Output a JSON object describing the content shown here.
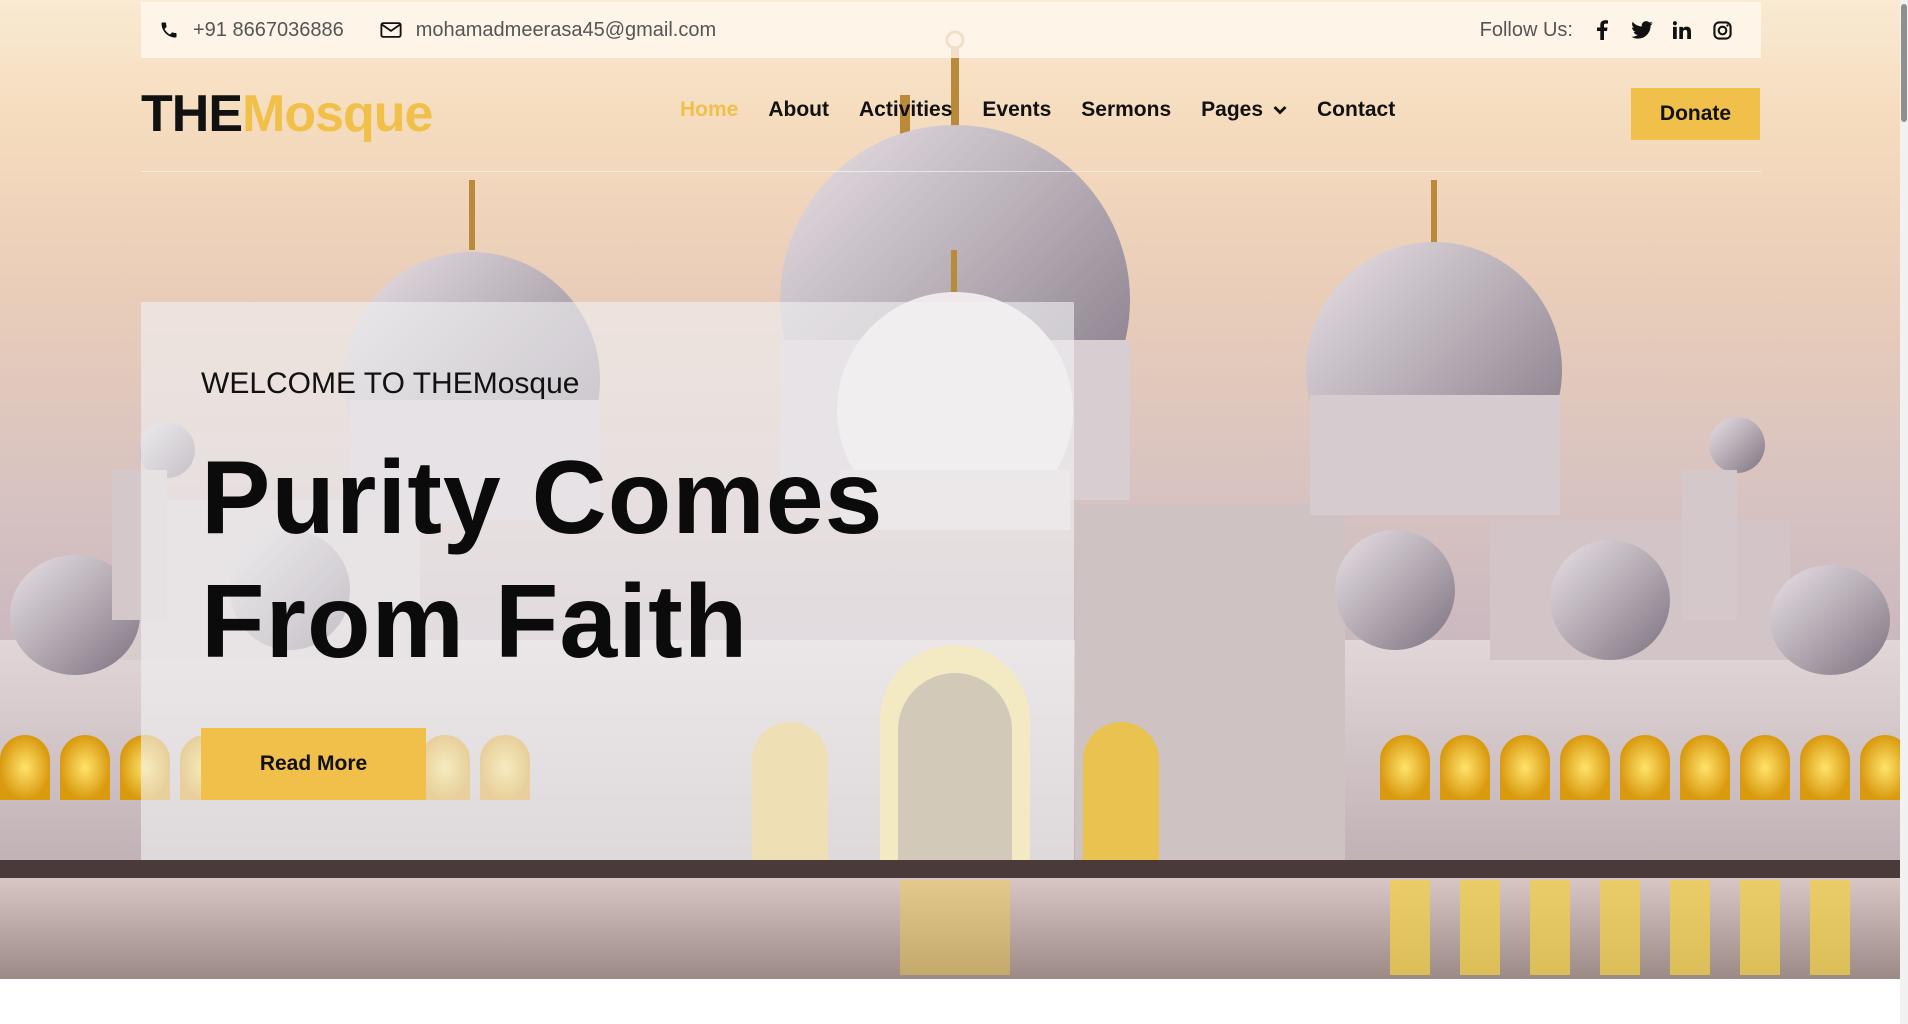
{
  "topbar": {
    "phone": "+91 8667036886",
    "email": "mohamadmeerasa45@gmail.com",
    "follow_label": "Follow Us:",
    "social_icons": [
      "facebook-icon",
      "twitter-icon",
      "linkedin-icon",
      "instagram-icon"
    ]
  },
  "brand": {
    "part1": "THE",
    "part2": "Mosque"
  },
  "nav": {
    "items": [
      {
        "label": "Home",
        "active": true
      },
      {
        "label": "About"
      },
      {
        "label": "Activities"
      },
      {
        "label": "Events"
      },
      {
        "label": "Sermons"
      },
      {
        "label": "Pages",
        "dropdown": true
      },
      {
        "label": "Contact"
      }
    ],
    "donate_label": "Donate"
  },
  "hero": {
    "welcome": "WELCOME TO THEMosque",
    "headline_line1": "Purity Comes",
    "headline_line2": "From Faith",
    "button_label": "Read More"
  },
  "colors": {
    "accent": "#f0c04a",
    "text_dark": "#111111",
    "text_muted": "#555555"
  }
}
